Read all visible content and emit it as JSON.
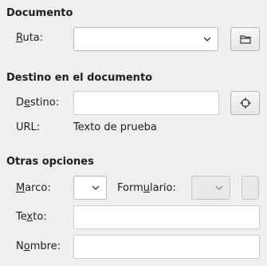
{
  "documento": {
    "title": "Documento",
    "ruta_label_mnemonic": "R",
    "ruta_label_rest": "uta:",
    "ruta_value": "",
    "browse_icon": "folder-icon"
  },
  "destino": {
    "title": "Destino en el documento",
    "destino_label_pre": "D",
    "destino_label_mnemonic": "e",
    "destino_label_rest": "stino:",
    "destino_value": "",
    "target_icon": "crosshair-icon",
    "url_label": "URL:",
    "url_value": "Texto de prueba"
  },
  "otras": {
    "title": "Otras opciones",
    "marco_label_mnemonic": "M",
    "marco_label_rest": "arco:",
    "marco_value": "",
    "formulario_label_pre": "Form",
    "formulario_label_mnemonic": "u",
    "formulario_label_rest": "lario:",
    "formulario_value": "",
    "texto_label_pre": "Te",
    "texto_label_mnemonic": "x",
    "texto_label_rest": "to:",
    "texto_value": "",
    "nombre_label_pre": "N",
    "nombre_label_mnemonic": "o",
    "nombre_label_rest": "mbre:",
    "nombre_value": ""
  }
}
